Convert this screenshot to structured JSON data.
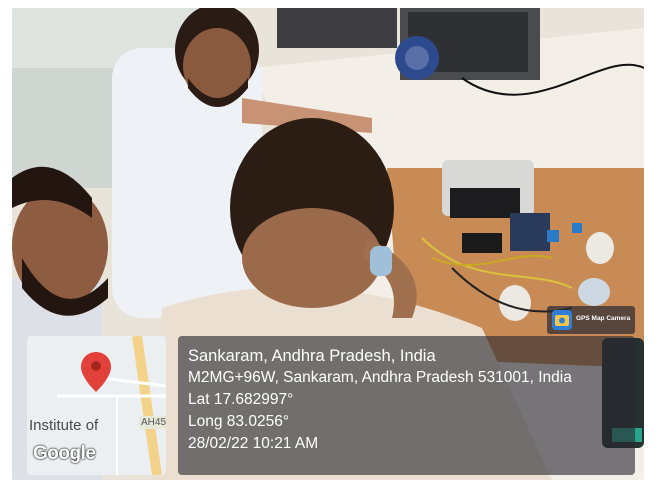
{
  "overlay": {
    "line1": "Sankaram, Andhra Pradesh, India",
    "line2": "M2MG+96W, Sankaram, Andhra Pradesh 531001, India",
    "line3": "Lat 17.682997°",
    "line4": "Long 83.0256°",
    "line5": "28/02/22 10:21 AM"
  },
  "map": {
    "label_institute": "Institute of",
    "label_road": "AH45",
    "logo": "Google"
  },
  "badge": {
    "text": "GPS Map Camera"
  },
  "colors": {
    "panel_bg": "#28282f",
    "pin": "#e2403a",
    "app_icon": "#2f7fd6"
  },
  "icons": [
    "map-pin-icon",
    "gps-map-camera-icon"
  ]
}
